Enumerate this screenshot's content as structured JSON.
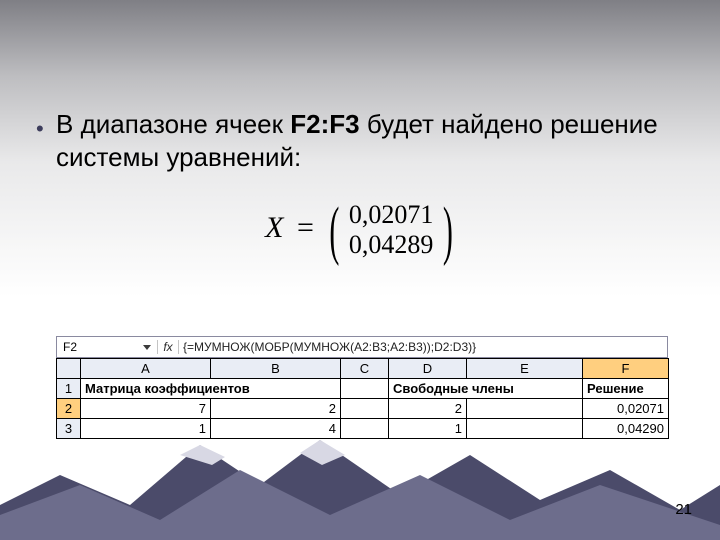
{
  "bullet": {
    "glyph": "•"
  },
  "text": {
    "line_pre": "В диапазоне ячеек ",
    "range": "F2:F3",
    "line_post": " будет найдено решение системы уравнений:"
  },
  "formula": {
    "X": "X",
    "eq": "=",
    "v1": "0,02071",
    "v2": "0,04289"
  },
  "excel": {
    "namebox": "F2",
    "fx": "fx",
    "formula": "{=МУМНОЖ(МОБР(МУМНОЖ(A2:B3;A2:B3));D2:D3)}",
    "cols": [
      "A",
      "B",
      "C",
      "D",
      "E",
      "F"
    ],
    "rows": [
      "1",
      "2",
      "3"
    ],
    "h_matrix": "Матрица коэффициентов",
    "h_free": "Свободные члены",
    "h_sol": "Решение",
    "r2": {
      "a": "7",
      "b": "2",
      "c": "",
      "d": "2",
      "e": "",
      "f": "0,02071"
    },
    "r3": {
      "a": "1",
      "b": "4",
      "c": "",
      "d": "1",
      "e": "",
      "f": "0,04290"
    }
  },
  "page": "21"
}
